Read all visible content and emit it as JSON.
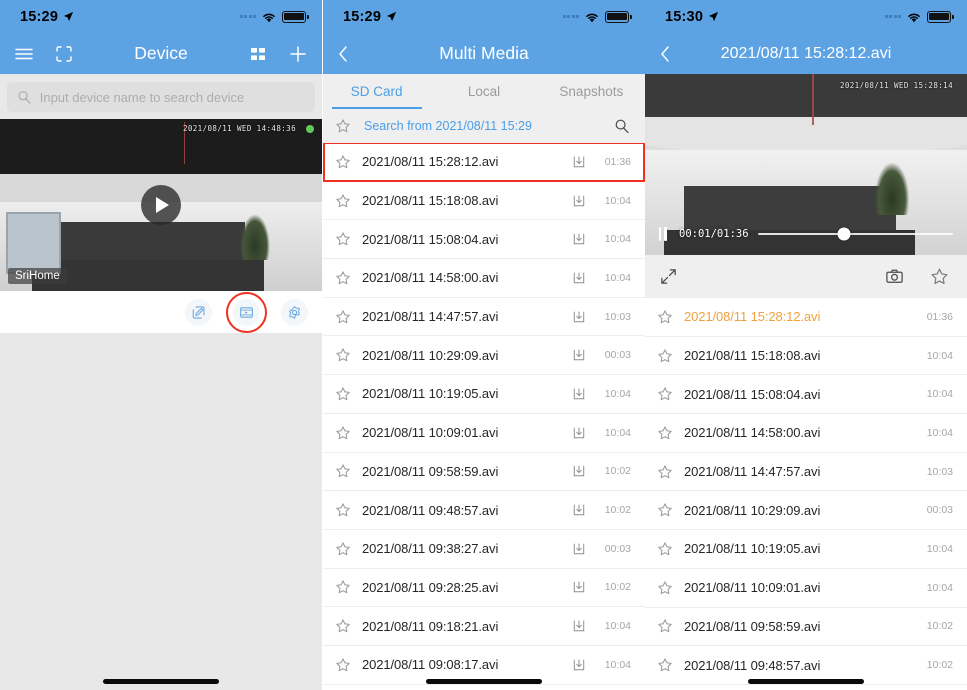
{
  "colors": {
    "header_blue": "#5da3e3",
    "accent_blue": "#4a9ee8",
    "active_orange": "#f0a03c",
    "highlight_red": "#ef3124",
    "online_green": "#62c95a"
  },
  "screen1": {
    "statusbar": {
      "time": "15:29",
      "signal": "signal-dots",
      "wifi": "wifi-icon",
      "battery": "battery-icon"
    },
    "navbar": {
      "menu_icon": "hamburger-menu-icon",
      "scan_icon": "qr-scan-icon",
      "title": "Device",
      "grid_icon": "grid-view-icon",
      "add_icon": "plus-icon"
    },
    "search": {
      "placeholder": "Input device name to search device",
      "value": "",
      "icon": "search-icon"
    },
    "device_card": {
      "overlay_timestamp": "2021/08/11  WED 14:48:36",
      "device_name": "SriHome",
      "online": true,
      "play_button": "play-icon",
      "actions": [
        {
          "name": "edit-device-button",
          "icon": "edit-square-icon",
          "highlighted": false
        },
        {
          "name": "multi-media-button",
          "icon": "video-playback-icon",
          "highlighted": true
        },
        {
          "name": "device-settings-button",
          "icon": "gear-icon",
          "highlighted": false
        }
      ]
    }
  },
  "screen2": {
    "statusbar": {
      "time": "15:29"
    },
    "navbar": {
      "back_icon": "back-chevron-icon",
      "title": "Multi Media"
    },
    "tabs": [
      {
        "label": "SD Card",
        "active": true
      },
      {
        "label": "Local",
        "active": false
      },
      {
        "label": "Snapshots",
        "active": false
      }
    ],
    "search_row": {
      "star_icon": "star-outline-icon",
      "text": "Search from 2021/08/11 15:29",
      "search_icon": "search-icon"
    },
    "files": [
      {
        "name": "2021/08/11 15:28:12.avi",
        "duration": "01:36",
        "highlighted": true,
        "download": true
      },
      {
        "name": "2021/08/11 15:18:08.avi",
        "duration": "10:04",
        "highlighted": false,
        "download": true
      },
      {
        "name": "2021/08/11 15:08:04.avi",
        "duration": "10:04",
        "highlighted": false,
        "download": true
      },
      {
        "name": "2021/08/11 14:58:00.avi",
        "duration": "10:04",
        "highlighted": false,
        "download": true
      },
      {
        "name": "2021/08/11 14:47:57.avi",
        "duration": "10:03",
        "highlighted": false,
        "download": true
      },
      {
        "name": "2021/08/11 10:29:09.avi",
        "duration": "00:03",
        "highlighted": false,
        "download": true
      },
      {
        "name": "2021/08/11 10:19:05.avi",
        "duration": "10:04",
        "highlighted": false,
        "download": true
      },
      {
        "name": "2021/08/11 10:09:01.avi",
        "duration": "10:04",
        "highlighted": false,
        "download": true
      },
      {
        "name": "2021/08/11 09:58:59.avi",
        "duration": "10:02",
        "highlighted": false,
        "download": true
      },
      {
        "name": "2021/08/11 09:48:57.avi",
        "duration": "10:02",
        "highlighted": false,
        "download": true
      },
      {
        "name": "2021/08/11 09:38:27.avi",
        "duration": "00:03",
        "highlighted": false,
        "download": true
      },
      {
        "name": "2021/08/11 09:28:25.avi",
        "duration": "10:02",
        "highlighted": false,
        "download": true
      },
      {
        "name": "2021/08/11 09:18:21.avi",
        "duration": "10:04",
        "highlighted": false,
        "download": true
      },
      {
        "name": "2021/08/11 09:08:17.avi",
        "duration": "10:04",
        "highlighted": false,
        "download": true
      }
    ]
  },
  "screen3": {
    "statusbar": {
      "time": "15:30"
    },
    "navbar": {
      "back_icon": "back-chevron-icon",
      "title": "2021/08/11 15:28:12.avi"
    },
    "player": {
      "overlay_timestamp": "2021/08/11  WED 15:28:14",
      "pause_icon": "pause-icon",
      "time_display": "00:01/01:36",
      "progress_percent": 44,
      "fullscreen_icon": "fullscreen-expand-icon",
      "snapshot_icon": "camera-icon",
      "favorite_icon": "star-outline-icon"
    },
    "files": [
      {
        "name": "2021/08/11 15:28:12.avi",
        "duration": "01:36",
        "active": true
      },
      {
        "name": "2021/08/11 15:18:08.avi",
        "duration": "10:04",
        "active": false
      },
      {
        "name": "2021/08/11 15:08:04.avi",
        "duration": "10:04",
        "active": false
      },
      {
        "name": "2021/08/11 14:58:00.avi",
        "duration": "10:04",
        "active": false
      },
      {
        "name": "2021/08/11 14:47:57.avi",
        "duration": "10:03",
        "active": false
      },
      {
        "name": "2021/08/11 10:29:09.avi",
        "duration": "00:03",
        "active": false
      },
      {
        "name": "2021/08/11 10:19:05.avi",
        "duration": "10:04",
        "active": false
      },
      {
        "name": "2021/08/11 10:09:01.avi",
        "duration": "10:04",
        "active": false
      },
      {
        "name": "2021/08/11 09:58:59.avi",
        "duration": "10:02",
        "active": false
      },
      {
        "name": "2021/08/11 09:48:57.avi",
        "duration": "10:02",
        "active": false
      }
    ]
  }
}
